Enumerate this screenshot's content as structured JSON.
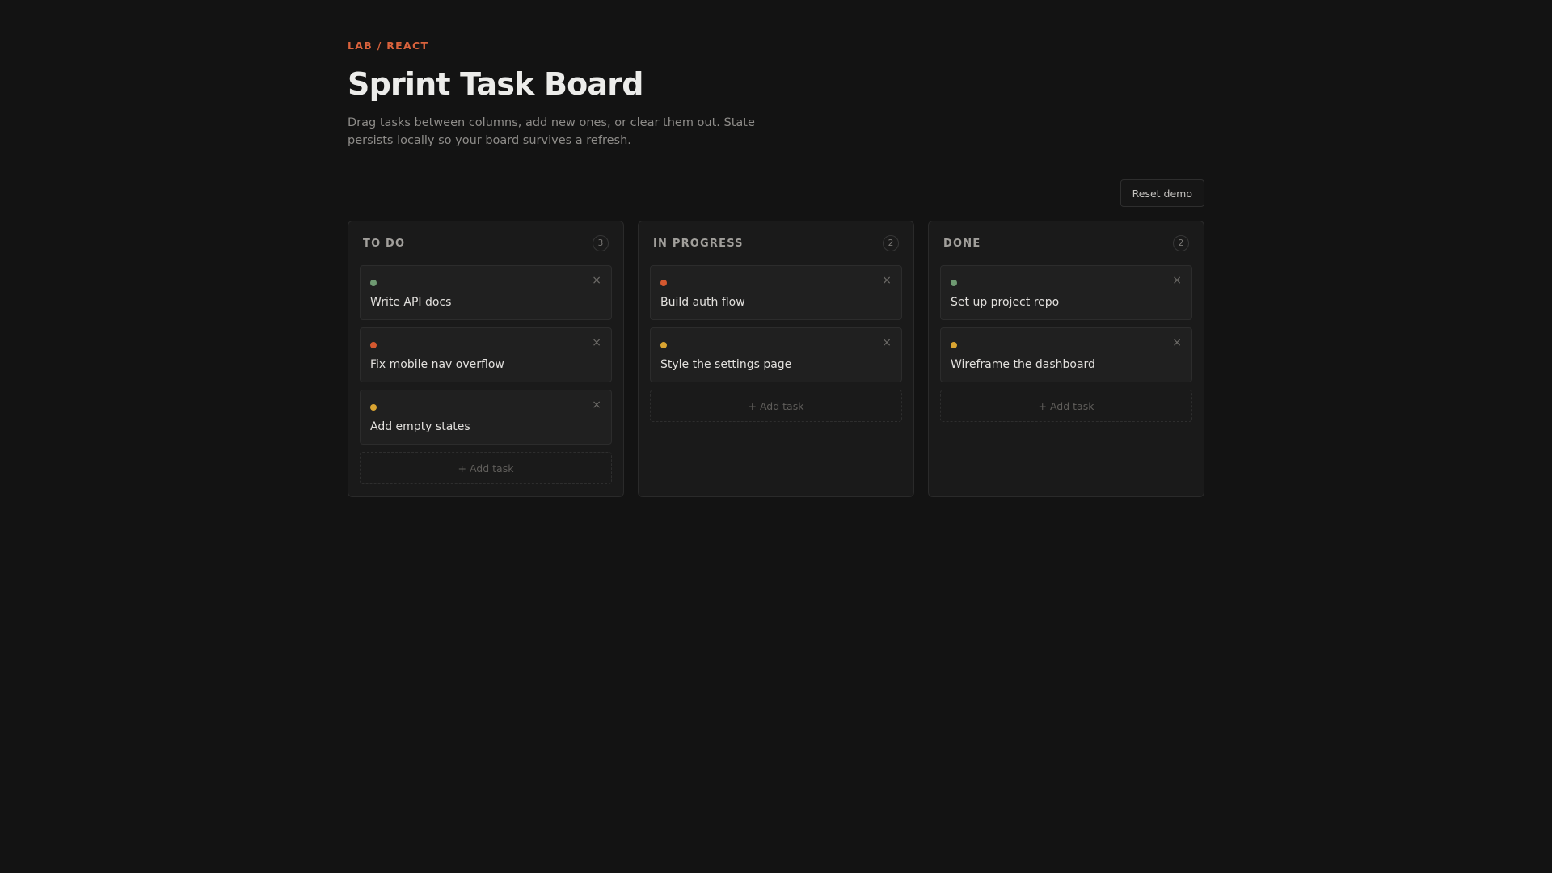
{
  "header": {
    "eyebrow": "LAB / REACT",
    "title": "Sprint Task Board",
    "subtitle": "Drag tasks between columns, add new ones, or clear them out. State persists locally so your board survives a refresh."
  },
  "toolbar": {
    "reset_label": "Reset demo"
  },
  "colors": {
    "accent": "#d9623c",
    "green": "#6f9a72",
    "red": "#d4582f",
    "yellow": "#d9a431"
  },
  "columns": [
    {
      "title": "TO DO",
      "count": "3",
      "add_label": "+ Add task",
      "tasks": [
        {
          "label": "Write API docs",
          "dot": "green",
          "close_glyph": "×"
        },
        {
          "label": "Fix mobile nav overflow",
          "dot": "red",
          "close_glyph": "×"
        },
        {
          "label": "Add empty states",
          "dot": "yellow",
          "close_glyph": "×"
        }
      ]
    },
    {
      "title": "IN PROGRESS",
      "count": "2",
      "add_label": "+ Add task",
      "tasks": [
        {
          "label": "Build auth flow",
          "dot": "red",
          "close_glyph": "×"
        },
        {
          "label": "Style the settings page",
          "dot": "yellow",
          "close_glyph": "×"
        }
      ]
    },
    {
      "title": "DONE",
      "count": "2",
      "add_label": "+ Add task",
      "tasks": [
        {
          "label": "Set up project repo",
          "dot": "green",
          "close_glyph": "×"
        },
        {
          "label": "Wireframe the dashboard",
          "dot": "yellow",
          "close_glyph": "×"
        }
      ]
    }
  ]
}
